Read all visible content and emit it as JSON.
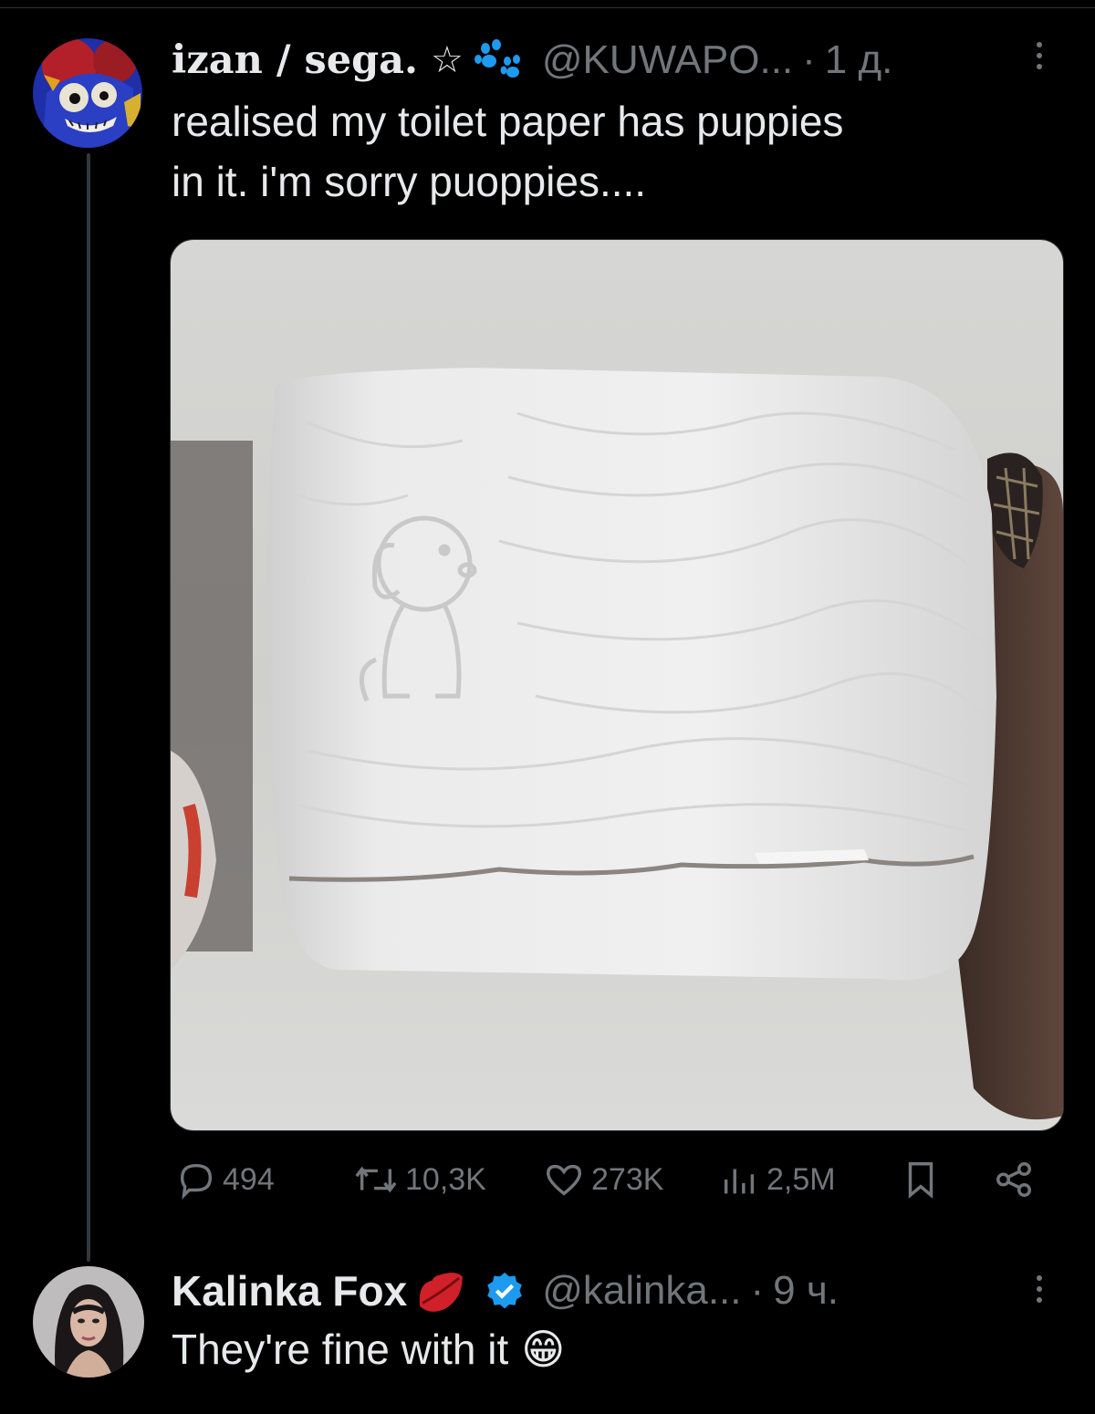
{
  "tweet": {
    "display_name": "izan / sega.",
    "name_symbol": "☆",
    "handle": "@KUWAPO...",
    "separator": "·",
    "time": "1 д.",
    "text_line1": "realised my toilet paper has puppies",
    "text_line2": "in it. i'm sorry puoppies....",
    "stats": {
      "replies": "494",
      "reposts": "10,3K",
      "likes": "273K",
      "views": "2,5M"
    }
  },
  "reply": {
    "display_name": "Kalinka Fox",
    "handle": "@kalinka...",
    "separator": "·",
    "time": "9 ч.",
    "text": "They're fine with it",
    "emoji": "😁"
  },
  "colors": {
    "background": "#000000",
    "text": "#e7e9ea",
    "muted": "#71767b",
    "verified": "#1d9bf0",
    "paw": "#1d9bf0"
  }
}
